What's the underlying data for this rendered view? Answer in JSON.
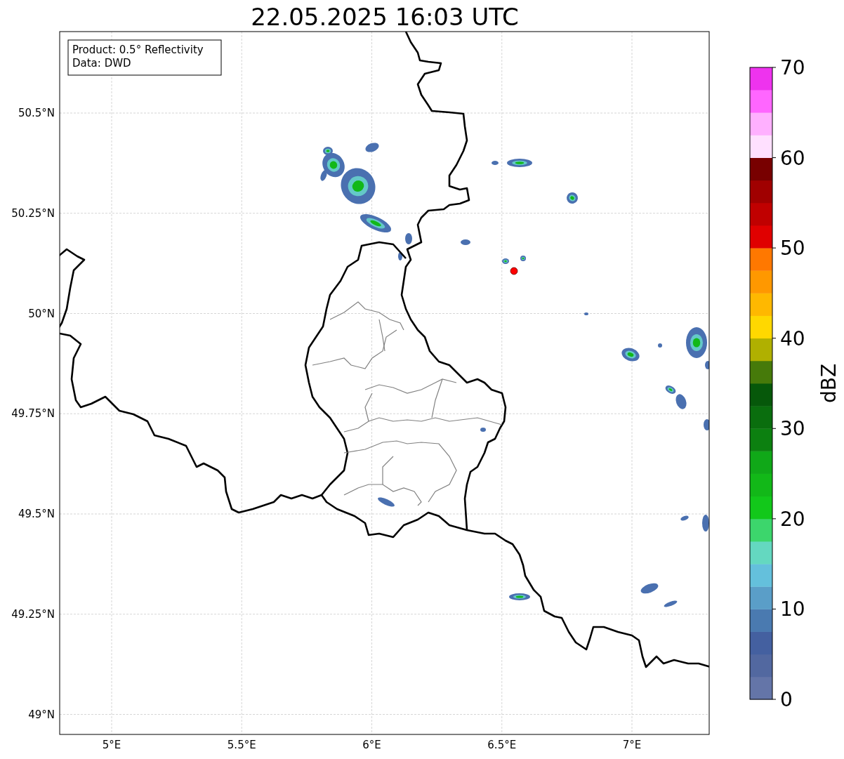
{
  "title": "22.05.2025 16:03 UTC",
  "info_box": [
    "Product: 0.5° Reflectivity",
    "Data: DWD"
  ],
  "map": {
    "xticks": [
      "5°E",
      "5.5°E",
      "6°E",
      "6.5°E",
      "7°E"
    ],
    "yticks": [
      "50.5°N",
      "50.25°N",
      "50°N",
      "49.75°N",
      "49.5°N",
      "49.25°N",
      "49°N"
    ]
  },
  "colorbar": {
    "label": "dBZ",
    "ticks": [
      "70",
      "60",
      "50",
      "40",
      "30",
      "20",
      "10",
      "0"
    ],
    "segments": [
      {
        "color": "#6475a8"
      },
      {
        "color": "#5268a0"
      },
      {
        "color": "#4460a0"
      },
      {
        "color": "#4a7ab0"
      },
      {
        "color": "#5a9ec8"
      },
      {
        "color": "#64c0dc"
      },
      {
        "color": "#64d8c0"
      },
      {
        "color": "#3cd66c"
      },
      {
        "color": "#12c81a"
      },
      {
        "color": "#12b818"
      },
      {
        "color": "#10a818"
      },
      {
        "color": "#0c8010"
      },
      {
        "color": "#0a6e0e"
      },
      {
        "color": "#06580a"
      },
      {
        "color": "#467a0a"
      },
      {
        "color": "#b0b000"
      },
      {
        "color": "#ffd800"
      },
      {
        "color": "#ffb800"
      },
      {
        "color": "#ff9800"
      },
      {
        "color": "#ff7800"
      },
      {
        "color": "#e00000"
      },
      {
        "color": "#c00000"
      },
      {
        "color": "#a00000"
      },
      {
        "color": "#780000"
      },
      {
        "color": "#ffe0ff"
      },
      {
        "color": "#ffb0ff"
      },
      {
        "color": "#ff66ff"
      },
      {
        "color": "#ee33ee"
      }
    ]
  }
}
